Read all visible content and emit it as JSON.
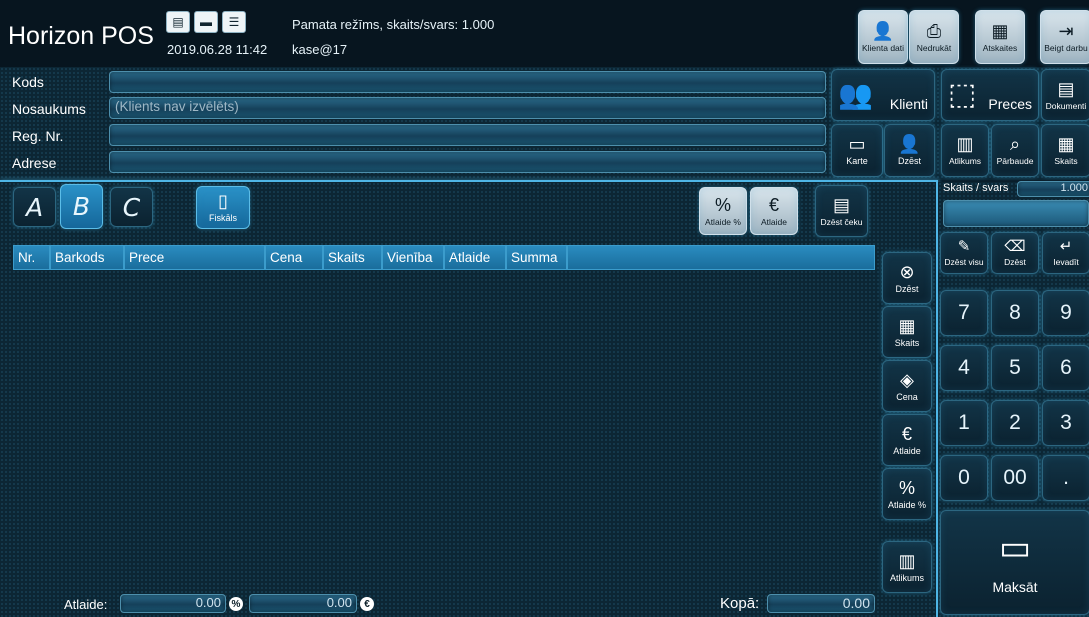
{
  "header": {
    "app_name": "Horizon POS",
    "datetime": "2019.06.28 11:42",
    "mode": "Pamata režīms, skaits/svars: 1.000",
    "user": "kase@17"
  },
  "top_actions": [
    {
      "label": "Klienta dati",
      "icon": "user-card-icon"
    },
    {
      "label": "Nedrukāt",
      "icon": "printer-off-icon"
    },
    {
      "label": "Atskaites",
      "icon": "reports-icon"
    },
    {
      "label": "Beigt darbu",
      "icon": "exit-icon"
    }
  ],
  "client": {
    "kods_label": "Kods",
    "kods_value": "",
    "nosaukums_label": "Nosaukums",
    "nosaukums_value": "(Klients nav izvēlēts)",
    "reg_label": "Reg. Nr.",
    "reg_value": "",
    "adrese_label": "Adrese",
    "adrese_value": ""
  },
  "client_buttons": {
    "klienti": "Klienti",
    "karte": "Karte",
    "dzest": "Dzēst"
  },
  "right_buttons": {
    "preces": "Preces",
    "dokumenti": "Dokumenti",
    "atlikums": "Atlikums",
    "parbaude": "Pārbaude",
    "skaits": "Skaits"
  },
  "tabs": {
    "a": "A",
    "b": "B",
    "c": "C",
    "fiskals": "Fiskāls"
  },
  "receipt_tools": {
    "atlaide_pct": "Atlaide %",
    "atlaide": "Atlaide",
    "dzest_ceku": "Dzēst čeku"
  },
  "table": {
    "columns": [
      "Nr.",
      "Barkods",
      "Prece",
      "Cena",
      "Skaits",
      "Vienība",
      "Atlaide",
      "Summa"
    ]
  },
  "line_tools": [
    "Dzēst",
    "Skaits",
    "Cena",
    "Atlaide",
    "Atlaide %",
    "Atlikums"
  ],
  "keypad": {
    "qty_label": "Skaits / svars",
    "qty_value": "1.000",
    "actions": [
      "Dzēst visu",
      "Dzēst",
      "Ievadīt"
    ],
    "keys": [
      "7",
      "8",
      "9",
      "4",
      "5",
      "6",
      "1",
      "2",
      "3",
      "0",
      "00",
      "."
    ],
    "pay": "Maksāt"
  },
  "footer": {
    "atlaide_label": "Atlaide:",
    "atlaide_pct_value": "0.00",
    "atlaide_eur_value": "0.00",
    "kopa_label": "Kopā:",
    "kopa_value": "0.00"
  },
  "colors": {
    "accent": "#2a8cc0",
    "background": "#0c2634",
    "header": "#07151f"
  }
}
